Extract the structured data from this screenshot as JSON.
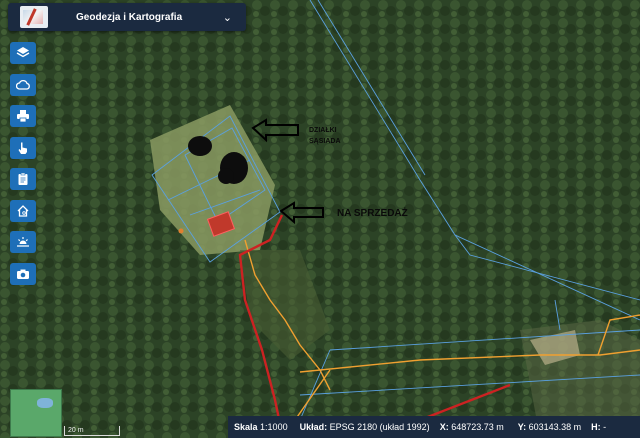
{
  "header": {
    "title": "Geodezja i Kartografia"
  },
  "toolbar": {
    "buttons": [
      {
        "icon": "layers-icon"
      },
      {
        "icon": "cloud-icon"
      },
      {
        "icon": "print-icon"
      },
      {
        "icon": "pointer-hand-icon"
      },
      {
        "icon": "clipboard-icon"
      },
      {
        "icon": "house-search-icon"
      },
      {
        "icon": "sunrise-icon"
      },
      {
        "icon": "camera-icon"
      }
    ]
  },
  "annotations": {
    "label1_line1": "DZIAŁKI",
    "label1_line2": "SĄSIADA",
    "label2": "NA SPRZEDAŻ"
  },
  "scalebar": {
    "label": "20 m"
  },
  "status": {
    "scale_label": "Skala",
    "scale_value": "1:1000",
    "crs_label": "Układ:",
    "crs_value": "EPSG 2180 (układ 1992)",
    "x_label": "X:",
    "x_value": "648723.73 m",
    "y_label": "Y:",
    "y_value": "603143.38 m",
    "h_label": "H:",
    "h_value": "-"
  },
  "colors": {
    "parcel_line": "#5aa0e0",
    "road": "#f0a030",
    "power_line": "#cc2222",
    "ui_dark": "#1b2a40",
    "button": "#1e6fb8"
  }
}
